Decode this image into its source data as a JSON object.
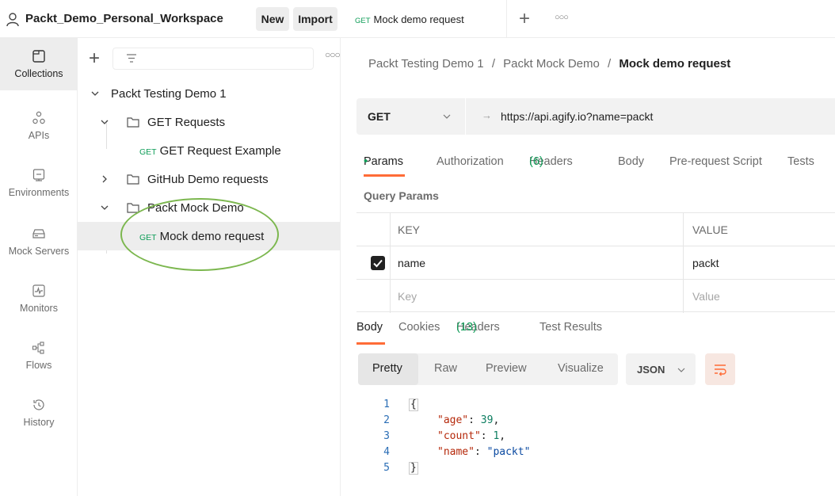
{
  "workspace": {
    "name": "Packt_Demo_Personal_Workspace",
    "new_label": "New",
    "import_label": "Import"
  },
  "rail": [
    {
      "label": "Collections",
      "icon": "collections-icon",
      "active": true
    },
    {
      "label": "APIs",
      "icon": "apis-icon"
    },
    {
      "label": "Environments",
      "icon": "environments-icon"
    },
    {
      "label": "Mock Servers",
      "icon": "mock-servers-icon"
    },
    {
      "label": "Monitors",
      "icon": "monitors-icon"
    },
    {
      "label": "Flows",
      "icon": "flows-icon"
    },
    {
      "label": "History",
      "icon": "history-icon"
    }
  ],
  "sidebar": {
    "tree": {
      "collection": "Packt Testing Demo 1",
      "folder_get": "GET Requests",
      "req_get_method": "GET",
      "req_get_label": "GET Request Example",
      "folder_github": "GitHub Demo requests",
      "folder_mock": "Packt Mock Demo",
      "req_mock_method": "GET",
      "req_mock_label": "Mock demo request"
    }
  },
  "tabs": {
    "active_method": "GET",
    "active_label": "Mock demo request"
  },
  "breadcrumb": {
    "part1": "Packt Testing Demo 1",
    "sep": "/",
    "part2": "Packt Mock Demo",
    "current": "Mock demo request"
  },
  "request": {
    "method": "GET",
    "url": "https://api.agify.io?name=packt"
  },
  "request_tabs": {
    "params": "Params",
    "params_dot": "•",
    "authorization": "Authorization",
    "headers": "Headers",
    "headers_count": "(6)",
    "body": "Body",
    "prerequest": "Pre-request Script",
    "tests": "Tests"
  },
  "query_params": {
    "title": "Query Params",
    "col_key": "KEY",
    "col_value": "VALUE",
    "row_key": "name",
    "row_value": "packt",
    "ph_key": "Key",
    "ph_value": "Value"
  },
  "response_tabs": {
    "body": "Body",
    "cookies": "Cookies",
    "headers": "Headers",
    "headers_count": "(13)",
    "test_results": "Test Results"
  },
  "format": {
    "pretty": "Pretty",
    "raw": "Raw",
    "preview": "Preview",
    "visualize": "Visualize",
    "language": "JSON"
  },
  "response_body": {
    "lines": [
      "1",
      "2",
      "3",
      "4",
      "5"
    ],
    "open": "{",
    "close": "}",
    "age_key": "\"age\"",
    "age_val": "39",
    "count_key": "\"count\"",
    "count_val": "1",
    "name_key": "\"name\"",
    "name_val": "\"packt\"",
    "colon": ": ",
    "comma": ","
  }
}
